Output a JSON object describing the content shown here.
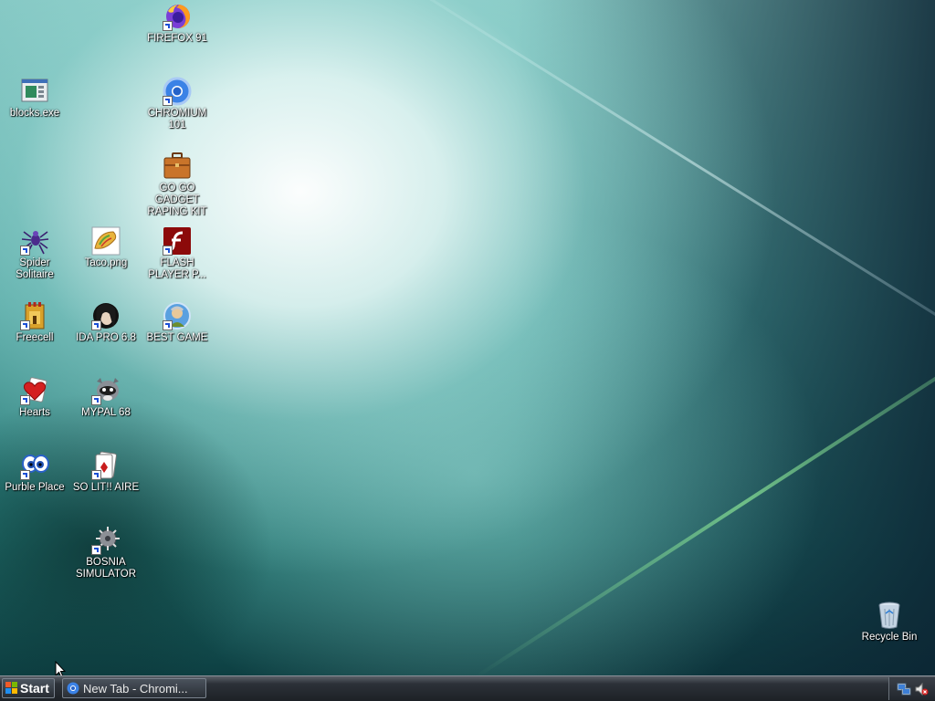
{
  "desktop": {
    "icons": [
      {
        "id": "firefox",
        "label": "FIREFOX 91",
        "icon": "firefox-icon"
      },
      {
        "id": "blocks",
        "label": "blocks.exe",
        "icon": "blocks-exe-icon"
      },
      {
        "id": "chromium",
        "label": "CHROMIUM 101",
        "icon": "chromium-icon"
      },
      {
        "id": "gadget",
        "label": "GO GO GADGET RAPING KIT",
        "icon": "briefcase-icon"
      },
      {
        "id": "spider",
        "label": "Spider Solitaire",
        "icon": "spider-icon"
      },
      {
        "id": "taco",
        "label": "Taco.png",
        "icon": "taco-icon"
      },
      {
        "id": "flash",
        "label": "FLASH PLAYER P...",
        "icon": "flash-icon"
      },
      {
        "id": "freecell",
        "label": "Freecell",
        "icon": "freecell-icon"
      },
      {
        "id": "ida",
        "label": "IDA PRO 6.8",
        "icon": "ida-icon"
      },
      {
        "id": "bestgame",
        "label": "BEST GAME",
        "icon": "best-game-icon"
      },
      {
        "id": "hearts",
        "label": "Hearts",
        "icon": "hearts-icon"
      },
      {
        "id": "mypal",
        "label": "MYPAL 68",
        "icon": "mypal-icon"
      },
      {
        "id": "purble",
        "label": "Purble Place",
        "icon": "purble-place-icon"
      },
      {
        "id": "solitaire",
        "label": "SO LIT!! AIRE",
        "icon": "solitaire-icon"
      },
      {
        "id": "bosnia",
        "label": "BOSNIA SIMULATOR",
        "icon": "bosnia-simulator-icon"
      },
      {
        "id": "recycle",
        "label": "Recycle Bin",
        "icon": "recycle-bin-icon"
      }
    ]
  },
  "taskbar": {
    "start_label": "Start",
    "tasks": [
      {
        "label": "New Tab - Chromi...",
        "icon": "chromium-icon"
      }
    ],
    "tray": {
      "icons": [
        "network-icon",
        "volume-muted-icon"
      ]
    }
  }
}
